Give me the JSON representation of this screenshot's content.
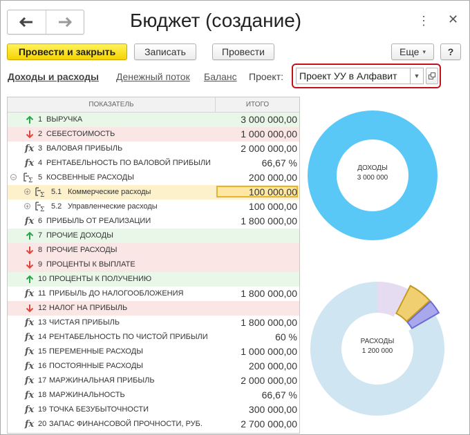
{
  "window": {
    "title": "Бюджет (создание)"
  },
  "toolbar": {
    "post_close": "Провести и закрыть",
    "save": "Записать",
    "post": "Провести",
    "more": "Еще",
    "help": "?"
  },
  "tabs": {
    "income_expense": "Доходы и расходы",
    "cash_flow": "Денежный поток",
    "balance": "Баланс"
  },
  "project": {
    "label": "Проект:",
    "value": "Проект УУ в Алфавит"
  },
  "table": {
    "col_indicator": "ПОКАЗАТЕЛЬ",
    "col_total": "ИТОГО",
    "rows": [
      {
        "icon": "arrow-up",
        "num": "1",
        "name": "ВЫРУЧКА",
        "value": "3 000 000,00",
        "type": "income"
      },
      {
        "icon": "arrow-down",
        "num": "2",
        "name": "СЕБЕСТОИМОСТЬ",
        "value": "1 000 000,00",
        "type": "expense"
      },
      {
        "icon": "fx",
        "num": "3",
        "name": "ВАЛОВАЯ ПРИБЫЛЬ",
        "value": "2 000 000,00",
        "type": "plain"
      },
      {
        "icon": "fx",
        "num": "4",
        "name": "РЕНТАБЕЛЬНОСТЬ ПО ВАЛОВОЙ ПРИБЫЛИ",
        "value": "66,67 %",
        "type": "plain"
      },
      {
        "icon": "group",
        "num": "5",
        "name": "КОСВЕННЫЕ РАСХОДЫ",
        "value": "200 000,00",
        "type": "plain",
        "expander": "−"
      },
      {
        "icon": "group",
        "num": "5.1",
        "name": "Коммерческие расходы",
        "value": "100 000,00",
        "type": "sel",
        "expander": "+",
        "child": true
      },
      {
        "icon": "group",
        "num": "5.2",
        "name": "Управленческие расходы",
        "value": "100 000,00",
        "type": "plain",
        "expander": "+",
        "child": true
      },
      {
        "icon": "fx",
        "num": "6",
        "name": "ПРИБЫЛЬ ОТ РЕАЛИЗАЦИИ",
        "value": "1 800 000,00",
        "type": "plain"
      },
      {
        "icon": "arrow-up",
        "num": "7",
        "name": "ПРОЧИЕ ДОХОДЫ",
        "value": "",
        "type": "income"
      },
      {
        "icon": "arrow-down",
        "num": "8",
        "name": "ПРОЧИЕ РАСХОДЫ",
        "value": "",
        "type": "expense"
      },
      {
        "icon": "arrow-down",
        "num": "9",
        "name": "ПРОЦЕНТЫ К ВЫПЛАТЕ",
        "value": "",
        "type": "expense"
      },
      {
        "icon": "arrow-up",
        "num": "10",
        "name": "ПРОЦЕНТЫ К ПОЛУЧЕНИЮ",
        "value": "",
        "type": "income"
      },
      {
        "icon": "fx",
        "num": "11",
        "name": "ПРИБЫЛЬ ДО НАЛОГООБЛОЖЕНИЯ",
        "value": "1 800 000,00",
        "type": "plain"
      },
      {
        "icon": "arrow-down",
        "num": "12",
        "name": "НАЛОГ НА ПРИБЫЛЬ",
        "value": "",
        "type": "expense"
      },
      {
        "icon": "fx",
        "num": "13",
        "name": "ЧИСТАЯ ПРИБЫЛЬ",
        "value": "1 800 000,00",
        "type": "plain"
      },
      {
        "icon": "fx",
        "num": "14",
        "name": "РЕНТАБЕЛЬНОСТЬ ПО ЧИСТОЙ ПРИБЫЛИ",
        "value": "60 %",
        "type": "plain"
      },
      {
        "icon": "fx",
        "num": "15",
        "name": "ПЕРЕМЕННЫЕ РАСХОДЫ",
        "value": "1 000 000,00",
        "type": "plain"
      },
      {
        "icon": "fx",
        "num": "16",
        "name": "ПОСТОЯННЫЕ РАСХОДЫ",
        "value": "200 000,00",
        "type": "plain"
      },
      {
        "icon": "fx",
        "num": "17",
        "name": "МАРЖИНАЛЬНАЯ ПРИБЫЛЬ",
        "value": "2 000 000,00",
        "type": "plain"
      },
      {
        "icon": "fx",
        "num": "18",
        "name": "МАРЖИНАЛЬНОСТЬ",
        "value": "66,67 %",
        "type": "plain"
      },
      {
        "icon": "fx",
        "num": "19",
        "name": "ТОЧКА БЕЗУБЫТОЧНОСТИ",
        "value": "300 000,00",
        "type": "plain"
      },
      {
        "icon": "fx",
        "num": "20",
        "name": "ЗАПАС ФИНАНСОВОЙ ПРОЧНОСТИ, РУБ.",
        "value": "2 700 000,00",
        "type": "plain"
      }
    ]
  },
  "colors": {
    "income_donut": "#59c8f7",
    "expense_base": "#cfe5f2",
    "expense_violet": "#a9a8ec",
    "expense_violet_edge": "#6c6bd6",
    "expense_gold": "#efcf6f",
    "expense_gold_edge": "#c29a1f",
    "expense_lilac": "#e6dcf1",
    "arrow_up": "#27a54a",
    "arrow_down": "#e0443a"
  },
  "chart_data": [
    {
      "type": "pie",
      "center_label": "ДОХОДЫ",
      "center_value": "3 000 000",
      "values": [
        3000000
      ]
    },
    {
      "type": "pie",
      "center_label": "РАСХОДЫ",
      "center_value": "1 200 000",
      "values": [
        1000000,
        40000,
        70000,
        90000
      ],
      "exploded": [
        false,
        true,
        true,
        false
      ]
    }
  ]
}
